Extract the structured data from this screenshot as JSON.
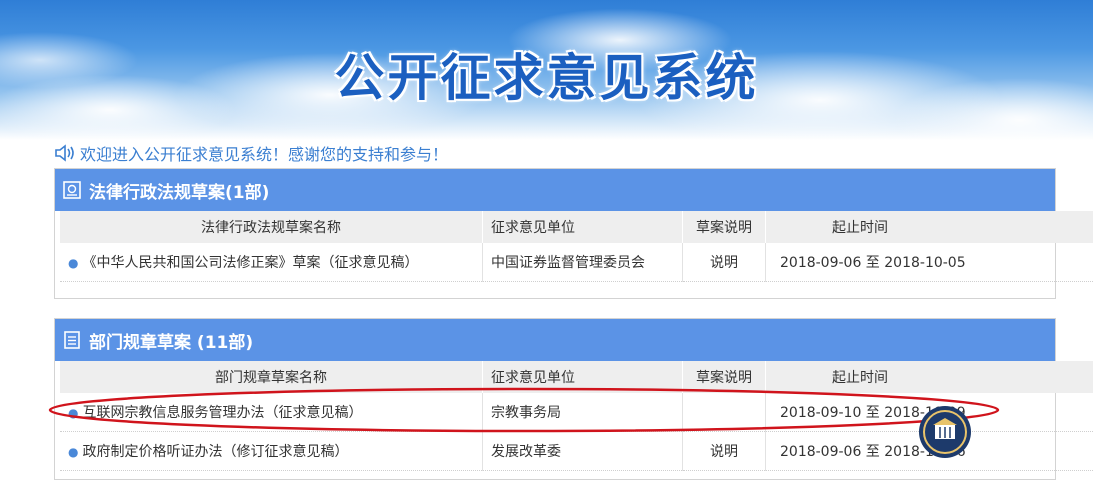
{
  "banner": {
    "title": "公开征求意见系统"
  },
  "welcome": {
    "text": "欢迎进入公开征求意见系统！感谢您的支持和参与！"
  },
  "colors": {
    "header_blue": "#5b93e6",
    "accent_blue": "#3b7fd1",
    "highlight_red": "#d0141c"
  },
  "sections": [
    {
      "title": "法律行政法规草案(1部)",
      "icon": "document-box-icon",
      "columns": [
        "法律行政法规草案名称",
        "征求意见单位",
        "草案说明",
        "起止时间"
      ],
      "rows": [
        {
          "name": "《中华人民共和国公司法修正案》草案（征求意见稿）",
          "unit": "中国证券监督管理委员会",
          "note": "说明",
          "period": "2018-09-06 至 2018-10-05"
        }
      ]
    },
    {
      "title": "部门规章草案 (11部)",
      "icon": "document-list-icon",
      "columns": [
        "部门规章草案名称",
        "征求意见单位",
        "草案说明",
        "起止时间"
      ],
      "rows": [
        {
          "name": "互联网宗教信息服务管理办法（征求意见稿）",
          "unit": "宗教事务局",
          "note": "",
          "period": "2018-09-10 至 2018-10-09"
        },
        {
          "name": "政府制定价格听证办法（修订征求意见稿）",
          "unit": "发展改革委",
          "note": "说明",
          "period": "2018-09-06 至 2018-10-06"
        }
      ]
    }
  ]
}
